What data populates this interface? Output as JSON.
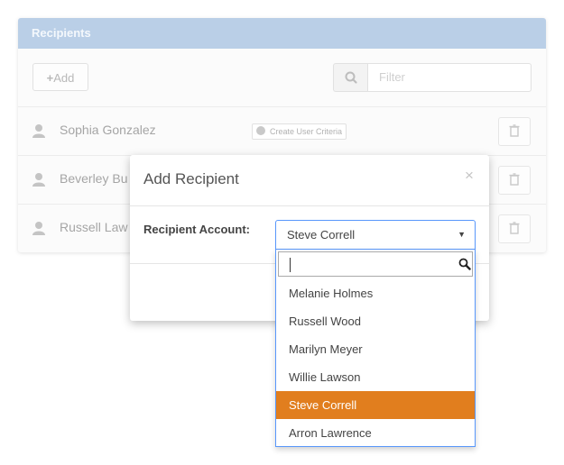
{
  "panel": {
    "title": "Recipients",
    "add_label": "Add",
    "filter_placeholder": "Filter",
    "rows": [
      {
        "name": "Sophia Gonzalez",
        "criteria_label": "Create User Criteria"
      },
      {
        "name": "Beverley Bu"
      },
      {
        "name": "Russell Law"
      }
    ]
  },
  "modal": {
    "title": "Add Recipient",
    "close_glyph": "×",
    "field_label": "Recipient Account:",
    "selected_value": "Steve Correll",
    "caret_glyph": "▼"
  },
  "dropdown": {
    "search_value": "",
    "options": [
      {
        "label": "Melanie Holmes"
      },
      {
        "label": "Russell Wood"
      },
      {
        "label": "Marilyn Meyer"
      },
      {
        "label": "Willie Lawson"
      },
      {
        "label": "Steve Correll",
        "selected": true
      },
      {
        "label": "Arron Lawrence"
      }
    ]
  },
  "colors": {
    "header": "#bacfe7",
    "accent_selected": "#e17e1e",
    "focus_border": "#5897fb"
  }
}
